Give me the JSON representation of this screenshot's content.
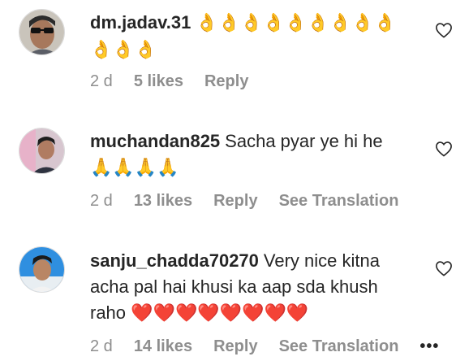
{
  "comments": [
    {
      "username": "dm.jadav.31",
      "text": "👌👌👌👌👌👌👌👌👌👌👌👌",
      "time": "2 d",
      "likes": "5 likes",
      "reply": "Reply"
    },
    {
      "username": "muchandan825",
      "text": "Sacha pyar ye hi he",
      "emojis": "🙏🙏🙏🙏",
      "time": "2 d",
      "likes": "13 likes",
      "reply": "Reply",
      "translation": "See Translation"
    },
    {
      "username": "sanju_chadda70270",
      "text": "Very nice kitna acha pal hai khusi ka aap sda khush raho",
      "emojis": "❤️❤️❤️❤️❤️❤️❤️❤️",
      "time": "2 d",
      "likes": "14 likes",
      "reply": "Reply",
      "translation": "See Translation",
      "more": "•••"
    }
  ],
  "colors": {
    "text": "#262626",
    "secondary": "#8e8e8e",
    "heart": "#e0142c",
    "emoji": "#f0b400"
  }
}
